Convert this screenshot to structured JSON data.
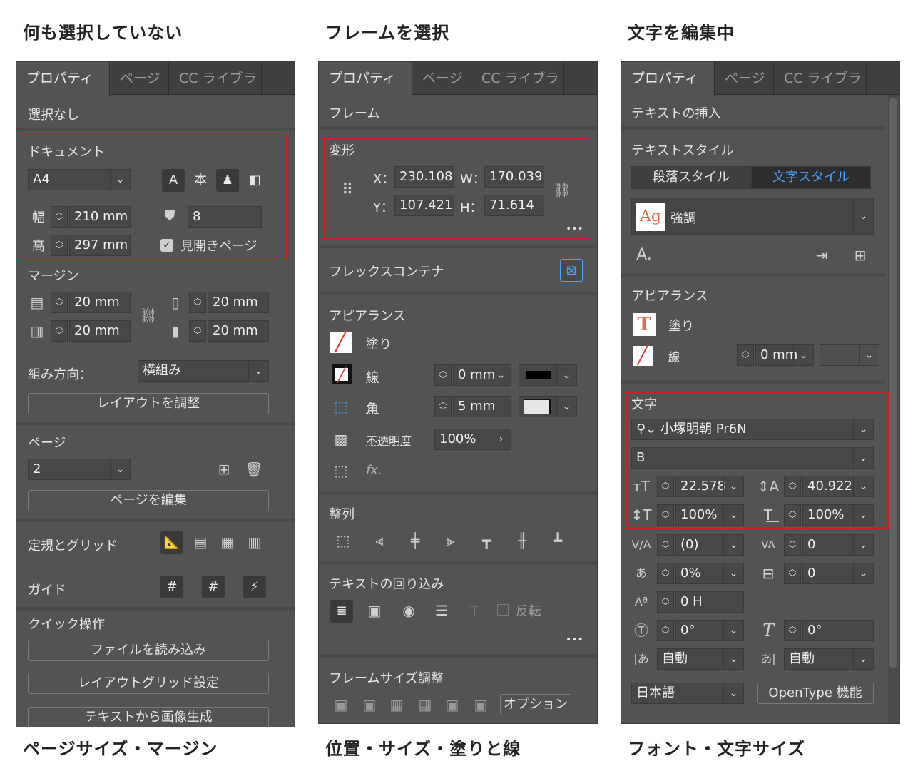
{
  "captions": {
    "top1": "何も選択していない",
    "top2": "フレームを選択",
    "top3": "文字を編集中",
    "bottom1": "ページサイズ・マージン",
    "bottom2": "位置・サイズ・塗りと線",
    "bottom3": "フォント・文字サイズ"
  },
  "tabs": {
    "properties": "プロパティ",
    "pages": "ページ",
    "cc": "CC ライブラ"
  },
  "panel1": {
    "status": "選択なし",
    "document_title": "ドキュメント",
    "page_size": "A4",
    "width_label": "幅",
    "width_value": "210 mm",
    "height_label": "高",
    "height_value": "297 mm",
    "pages_count": "8",
    "facing_pages": "見開きページ",
    "margin_title": "マージン",
    "margin_top": "20 mm",
    "margin_bottom": "20 mm",
    "margin_inside": "20 mm",
    "margin_outside": "20 mm",
    "direction_label": "組み方向：",
    "direction_value": "横組み",
    "adjust_layout": "レイアウトを調整",
    "page_title": "ページ",
    "page_value": "2",
    "edit_page": "ページを編集",
    "rulers_grids": "定規とグリッド",
    "guides": "ガイド",
    "quick_actions": "クイック操作",
    "import_file": "ファイルを読み込み",
    "layout_grid": "レイアウトグリッド設定",
    "text_to_image": "テキストから画像生成"
  },
  "panel2": {
    "status": "フレーム",
    "transform_title": "変形",
    "x_label": "X：",
    "x_value": "230.108",
    "y_label": "Y：",
    "y_value": "107.421",
    "w_label": "W：",
    "w_value": "170.039",
    "h_label": "H：",
    "h_value": "71.614",
    "more": "•••",
    "flex_container": "フレックスコンテナ",
    "appearance_title": "アピアランス",
    "fill": "塗り",
    "stroke": "線",
    "stroke_value": "0 mm",
    "corner": "角",
    "corner_value": "5 mm",
    "opacity": "不透明度",
    "opacity_value": "100%",
    "fx": "fx.",
    "align_title": "整列",
    "wrap_title": "テキストの回り込み",
    "invert": "反転",
    "fitting_title": "フレームサイズ調整",
    "options": "オプション"
  },
  "panel3": {
    "insert_text": "テキストの挿入",
    "text_style_title": "テキストスタイル",
    "para_style": "段落スタイル",
    "char_style": "文字スタイル",
    "style_preview": "Ag",
    "style_name": "強調",
    "appearance_title": "アピアランス",
    "fill": "塗り",
    "stroke": "線",
    "stroke_value": "0 mm",
    "char_title": "文字",
    "font_family": "小塚明朝 Pr6N",
    "font_style": "B",
    "font_size": "22.578",
    "leading": "40.922",
    "vert_scale": "100%",
    "horiz_scale": "100%",
    "kerning": "(0)",
    "tracking": "0",
    "tsume": "0%",
    "aki": "0",
    "baseline": "0 H",
    "rotation": "0°",
    "skew": "0°",
    "aki_before": "自動",
    "aki_after": "自動",
    "language": "日本語",
    "opentype": "OpenType 機能"
  },
  "colors": {
    "panel_bg": "#535353",
    "highlight_red": "#d81c1c",
    "active_blue": "#4aa3ff",
    "swatch_red": "#e0322a"
  }
}
